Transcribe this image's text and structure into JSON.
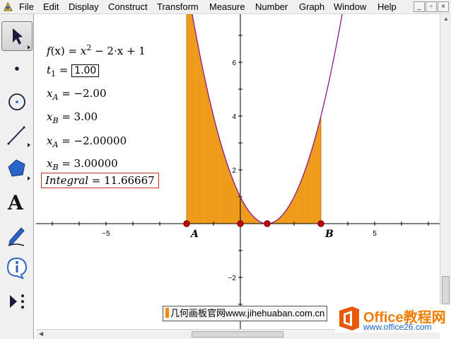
{
  "menubar": {
    "items": [
      "File",
      "Edit",
      "Display",
      "Construct",
      "Transform",
      "Measure",
      "Number",
      "Graph",
      "Window",
      "Help"
    ],
    "window_buttons": [
      "_",
      "▫",
      "×"
    ]
  },
  "toolbox": {
    "tools": [
      "arrow-select-tool",
      "point-tool",
      "compass-tool",
      "straightedge-tool",
      "polygon-tool",
      "text-tool",
      "marker-tool",
      "information-tool",
      "custom-tool"
    ],
    "text_tool_glyph": "A",
    "selected": "arrow-select-tool"
  },
  "measurements": {
    "function_def": "f(x) = x² − 2·x + 1",
    "f_name": "f",
    "f_paren": "(x)",
    "f_eq": " = ",
    "f_x": "x",
    "f_exp": "2",
    "f_rest": " − 2·x + 1",
    "t1_name": "t",
    "t1_sub": "1",
    "t1_eq": " = ",
    "t1_value": "1.00",
    "xa1_name": "x",
    "xa1_sub": "A",
    "xa1_rest": " = −2.00",
    "xb1_name": "x",
    "xb1_sub": "B",
    "xb1_rest": " = 3.00",
    "xa2_name": "x",
    "xa2_sub": "A",
    "xa2_rest": " = −2.00000",
    "xb2_name": "x",
    "xb2_sub": "B",
    "xb2_rest": " = 3.00000",
    "integral_name": "Integral",
    "integral_rest": " = 11.66667"
  },
  "graph": {
    "function_color": "#8b1a8b",
    "fill_color": "#f5a020",
    "point_color": "#cc0000",
    "x_tick_labels": [
      "−5",
      "5"
    ],
    "y_tick_labels": [
      "6",
      "4",
      "2",
      "−2",
      "−4"
    ],
    "points": [
      {
        "label": "A",
        "x": -2
      },
      {
        "label": "",
        "x": 0
      },
      {
        "label": "",
        "x": 1
      },
      {
        "label": "B",
        "x": 3
      }
    ]
  },
  "watermarks": {
    "left_text": "几何画板官网www.jihehuaban.com.cn",
    "right_title": "Office教程网",
    "right_url": "www.office26.com"
  }
}
